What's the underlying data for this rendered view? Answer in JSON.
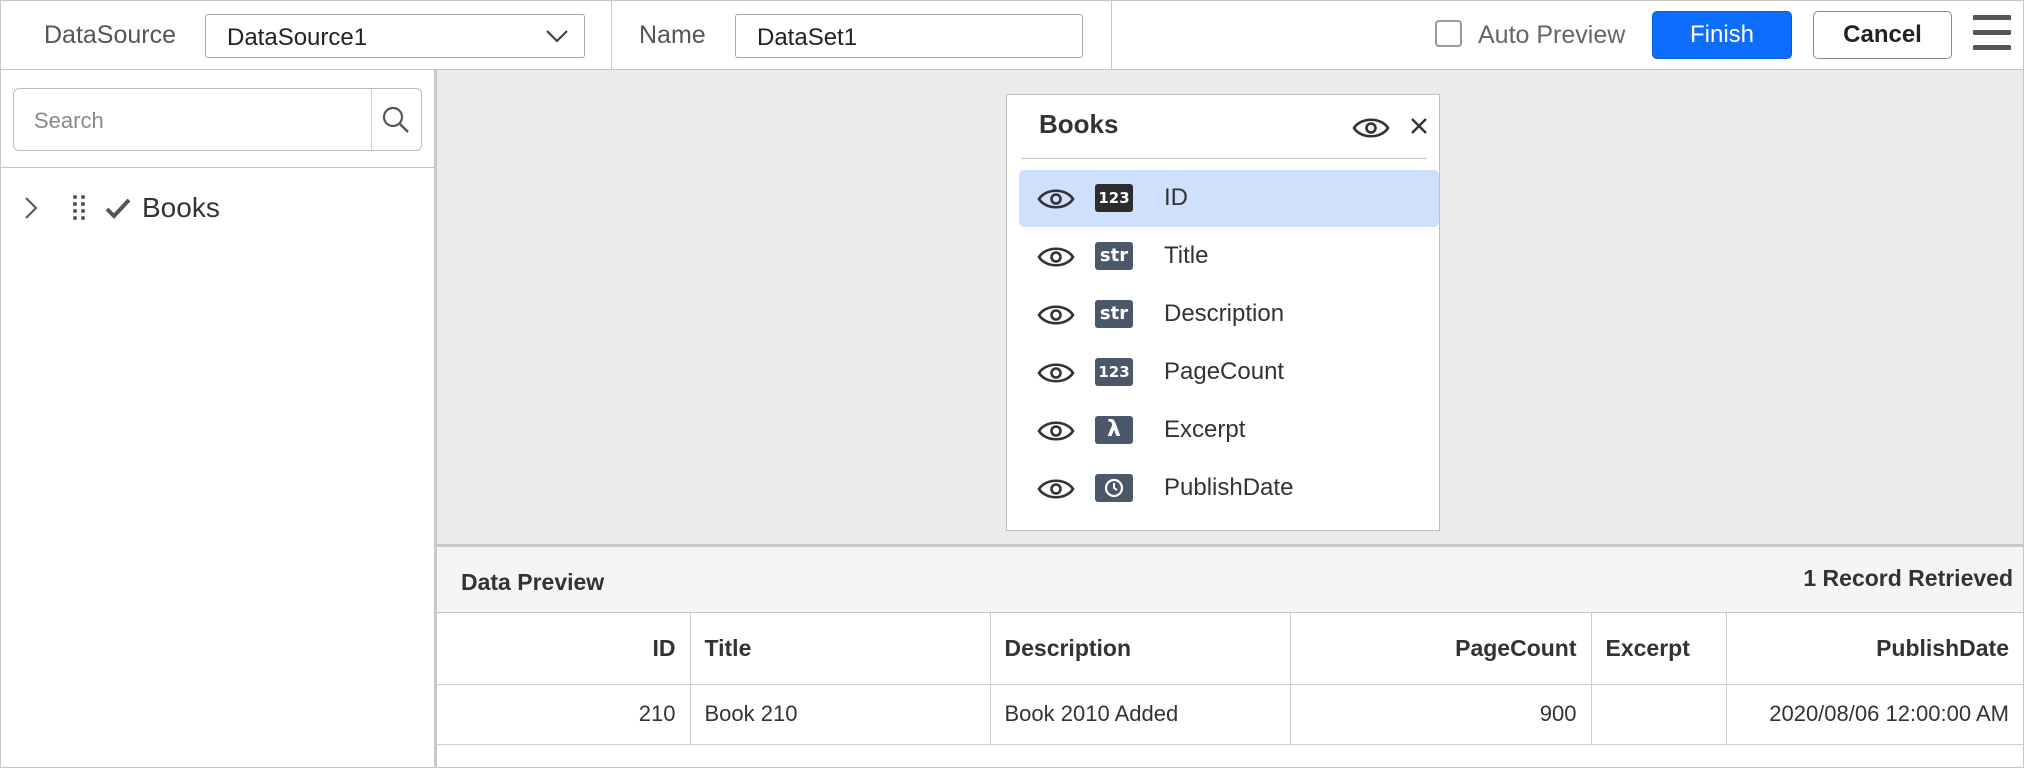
{
  "toolbar": {
    "datasource_label": "DataSource",
    "datasource_value": "DataSource1",
    "name_label": "Name",
    "name_value": "DataSet1",
    "auto_preview_label": "Auto Preview",
    "auto_preview_checked": false,
    "finish_label": "Finish",
    "cancel_label": "Cancel"
  },
  "left_panel": {
    "search_placeholder": "Search",
    "tree": [
      {
        "label": "Books",
        "checked": true,
        "expanded": false
      }
    ]
  },
  "table_card": {
    "title": "Books",
    "fields": [
      {
        "name": "ID",
        "type": "123",
        "selected": true
      },
      {
        "name": "Title",
        "type": "str",
        "selected": false
      },
      {
        "name": "Description",
        "type": "str",
        "selected": false
      },
      {
        "name": "PageCount",
        "type": "123",
        "selected": false
      },
      {
        "name": "Excerpt",
        "type": "λ",
        "selected": false
      },
      {
        "name": "PublishDate",
        "type": "date-icon",
        "selected": false
      }
    ]
  },
  "preview": {
    "title": "Data Preview",
    "record_count": "1 Record Retrieved",
    "columns": [
      "ID",
      "Title",
      "Description",
      "PageCount",
      "Excerpt",
      "PublishDate"
    ],
    "rows": [
      [
        "210",
        "Book 210",
        "Book 2010 Added",
        "900",
        "",
        "2020/08/06 12:00:00 AM"
      ]
    ]
  },
  "colors": {
    "accent": "#0d6efd",
    "selection": "#cfe0fc",
    "type_badge": "#4b5869",
    "canvas_bg": "#ebebeb"
  }
}
